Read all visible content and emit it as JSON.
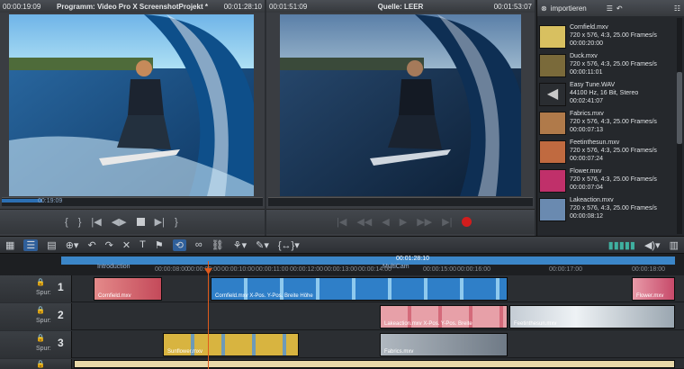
{
  "program_monitor": {
    "timecode_left": "00:00:19:09",
    "title": "Programm: Video Pro X  ScreenshotProjekt *",
    "timecode_right": "00:01:28:10",
    "scrub_tc": "00:19:09"
  },
  "source_monitor": {
    "timecode_left": "00:01:51:09",
    "title": "Quelle: LEER",
    "timecode_right": "00:01:53:07"
  },
  "program_controls": [
    "{",
    "}",
    "|◀",
    "◀▶",
    "■",
    "▶|",
    "}"
  ],
  "media_pool": {
    "import_label": "importieren",
    "items": [
      {
        "name": "Cornfield.mxv",
        "line2": "720 x 576, 4:3, 25.00 Frames/s",
        "line3": "00:00:20:00",
        "color": "#d8c060"
      },
      {
        "name": "Duck.mxv",
        "line2": "720 x 576, 4:3, 25.00 Frames/s",
        "line3": "00:00:11:01",
        "color": "#7a6a3a"
      },
      {
        "name": "Easy Tune.WAV",
        "line2": "44100 Hz, 16 Bit, Stereo",
        "line3": "00:02:41:07",
        "color": "#c8c8c8"
      },
      {
        "name": "Fabrics.mxv",
        "line2": "720 x 576, 4:3, 25.00 Frames/s",
        "line3": "00:00:07:13",
        "color": "#b07a4a"
      },
      {
        "name": "Feetinthesun.mxv",
        "line2": "720 x 576, 4:3, 25.00 Frames/s",
        "line3": "00:00:07:24",
        "color": "#c06a40"
      },
      {
        "name": "Flower.mxv",
        "line2": "720 x 576, 4:3, 25.00 Frames/s",
        "line3": "00:00:07:04",
        "color": "#c0306a"
      },
      {
        "name": "Lakeaction.mxv",
        "line2": "720 x 576, 4:3, 25.00 Frames/s",
        "line3": "00:00:08:12",
        "color": "#6a8ab0"
      }
    ]
  },
  "ruler": {
    "timecode": "00:01:28:10",
    "marker_intro": "Introduction",
    "marker_multicam": "MultiCam",
    "ticks": [
      "00:00:08:00",
      "00:00:09:00",
      "00:00:10:00",
      "00:00:11:00",
      "00:00:12:00",
      "00:00:13:00",
      "00:00:14:00",
      "00:00:15:00",
      "00:00:16:00",
      "00:00:17:00",
      "00:00:18:00"
    ]
  },
  "tracks": [
    {
      "number": "1",
      "label": "Spur:"
    },
    {
      "number": "2",
      "label": "Spur:"
    },
    {
      "number": "3",
      "label": "Spur:"
    },
    {
      "number": "4",
      "label": ""
    }
  ],
  "clips": {
    "cornfield_a": "Cornfield.mxv",
    "cornfield_b": "Cornfield.mxv  X-Pos.  Y-Pos.  Breite  Höhe",
    "flower_a": "Flower.mxv",
    "lake": "Lakeaction.mxv  X-Pos.  Y-Pos.  Breite",
    "feet": "Feetinthesun.mxv",
    "fabrics": "Fabrics.mxv",
    "sunflower": "Sunflower.mxv"
  },
  "colors": {
    "accent": "#3b86c8",
    "playhead": "#e05a1c",
    "record": "#d21d1d"
  }
}
